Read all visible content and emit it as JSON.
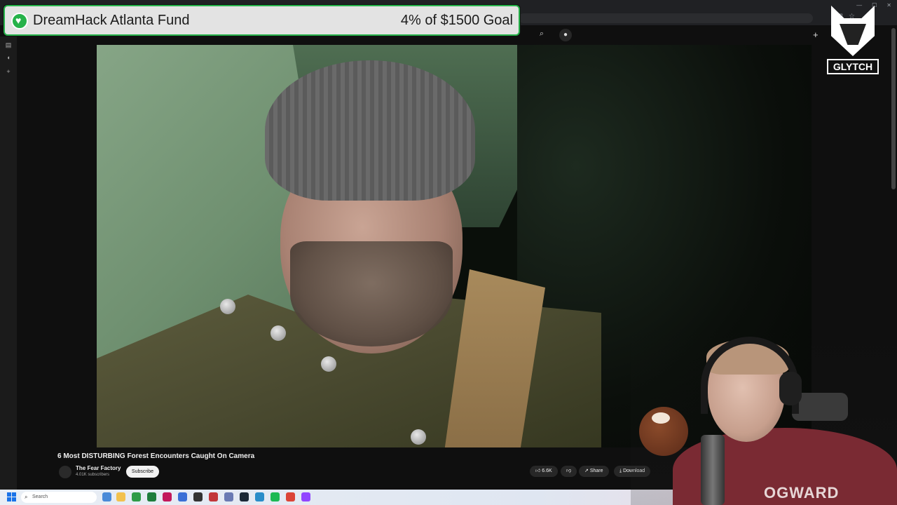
{
  "banner": {
    "title": "DreamHack Atlanta Fund",
    "goal": "4% of $1500 Goal"
  },
  "logo": {
    "text": "GLYTCH"
  },
  "video": {
    "title": "6 Most DISTURBING Forest Encounters Caught On Camera",
    "channel_name": "The Fear Factory",
    "subscribers": "4.01K subscribers",
    "subscribe_label": "Subscribe",
    "likes": "6.6K",
    "share_label": "Share",
    "download_label": "Download"
  },
  "webcam": {
    "shirt_text": "OGWARD"
  },
  "taskbar": {
    "search_placeholder": "Search"
  },
  "colors": {
    "accent_green": "#26b24a",
    "yt_bg": "#0f0f0f"
  },
  "icons": [
    "search-icon",
    "mic-icon",
    "create-icon",
    "like-icon",
    "dislike-icon",
    "share-icon",
    "download-icon",
    "windows-start-icon"
  ]
}
